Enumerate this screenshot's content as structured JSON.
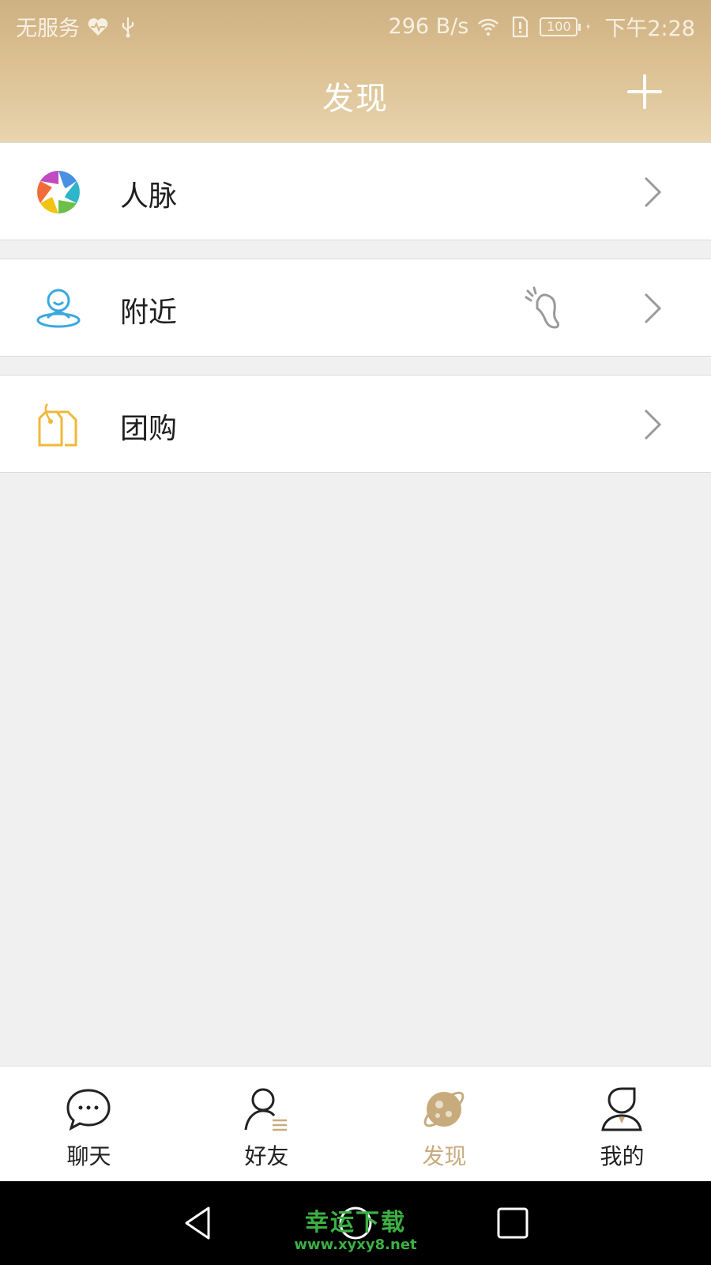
{
  "status_bar": {
    "carrier": "无服务",
    "network_speed": "296 B/s",
    "battery": "100",
    "time": "下午2:28"
  },
  "header": {
    "title": "发现",
    "add_icon": "plus-icon"
  },
  "list": [
    {
      "label": "人脉",
      "icon": "aperture-icon"
    },
    {
      "label": "附近",
      "icon": "location-person-icon",
      "extra_icon": "footprint-icon"
    },
    {
      "label": "团购",
      "icon": "price-tag-icon"
    }
  ],
  "tabs": [
    {
      "label": "聊天",
      "icon": "chat-bubble-icon",
      "active": false
    },
    {
      "label": "好友",
      "icon": "contacts-icon",
      "active": false
    },
    {
      "label": "发现",
      "icon": "planet-icon",
      "active": true
    },
    {
      "label": "我的",
      "icon": "profile-icon",
      "active": false
    }
  ],
  "colors": {
    "header_gold": "#d6bb8c",
    "active_tab": "#c8ab7d",
    "background": "#f0f0f0",
    "watermark": "#3cb043"
  },
  "watermark": {
    "text": "幸运下载",
    "url": "www.xyxy8.net"
  }
}
